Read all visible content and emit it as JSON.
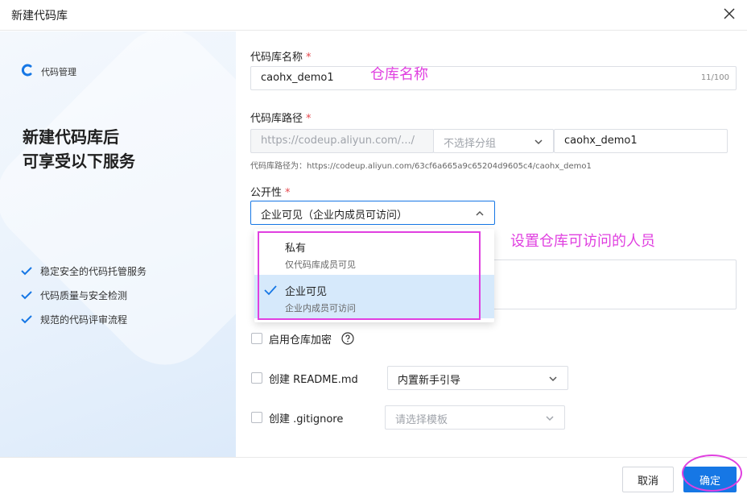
{
  "dialog": {
    "title": "新建代码库"
  },
  "left": {
    "brand": "代码管理",
    "headline_line1": "新建代码库后",
    "headline_line2": "可享受以下服务",
    "features": [
      "稳定安全的代码托管服务",
      "代码质量与安全检测",
      "规范的代码评审流程"
    ]
  },
  "form": {
    "name": {
      "label": "代码库名称",
      "required_mark": "*",
      "value": "caohx_demo1",
      "counter": "11/100"
    },
    "path": {
      "label": "代码库路径",
      "required_mark": "*",
      "prefix": "https://codeup.aliyun.com/.../",
      "group_placeholder": "不选择分组",
      "value": "caohx_demo1",
      "hint": "代码库路径为：https://codeup.aliyun.com/63cf6a665a9c65204d9605c4/caohx_demo1"
    },
    "visibility": {
      "label": "公开性",
      "required_mark": "*",
      "selected": "企业可见（企业内成员可访问）",
      "options": [
        {
          "title": "私有",
          "desc": "仅代码库成员可见"
        },
        {
          "title": "企业可见",
          "desc": "企业内成员可访问"
        }
      ]
    },
    "encrypt": {
      "label": "启用仓库加密",
      "checked": false
    },
    "readme": {
      "label": "创建 README.md",
      "checked": false,
      "select_value": "内置新手引导"
    },
    "gitignore": {
      "label": "创建 .gitignore",
      "checked": false,
      "select_placeholder": "请选择模板"
    }
  },
  "annotations": {
    "name_note": "仓库名称",
    "visibility_note": "设置仓库可访问的人员",
    "color": "#e040e0"
  },
  "footer": {
    "cancel": "取消",
    "ok": "确定"
  },
  "colors": {
    "primary": "#1677e5",
    "selected_bg": "#d6e9fb"
  }
}
